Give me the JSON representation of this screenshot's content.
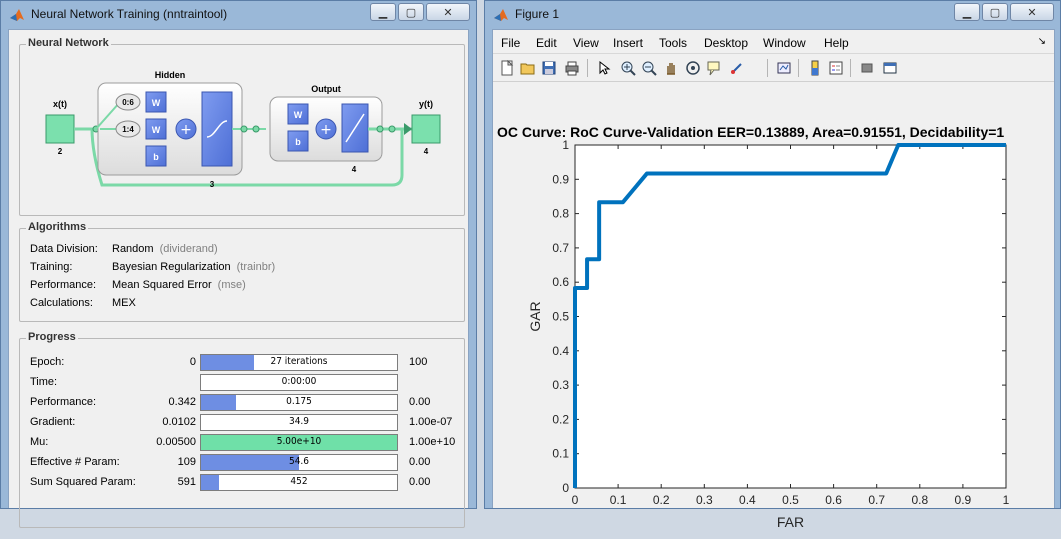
{
  "nntool": {
    "title": "Neural Network Training (nntraintool)",
    "network": {
      "panel_title": "Neural Network",
      "input_label": "x(t)",
      "input_size": "2",
      "hidden_label": "Hidden",
      "hidden_delay1": "0:6",
      "hidden_delay2": "1:4",
      "hidden_size": "3",
      "output_label": "Output",
      "output_size": "4",
      "y_label": "y(t)",
      "y_size": "4",
      "w": "W",
      "b": "b"
    },
    "algorithms": {
      "panel_title": "Algorithms",
      "rows": [
        {
          "label": "Data Division:",
          "value": "Random",
          "paren": "(dividerand)"
        },
        {
          "label": "Training:",
          "value": "Bayesian Regularization",
          "paren": "(trainbr)"
        },
        {
          "label": "Performance:",
          "value": "Mean Squared Error",
          "paren": "(mse)"
        },
        {
          "label": "Calculations:",
          "value": "MEX",
          "paren": ""
        }
      ]
    },
    "progress": {
      "panel_title": "Progress",
      "rows": [
        {
          "label": "Epoch:",
          "start": "0",
          "bar_text": "27 iterations",
          "end": "100",
          "fill": 0.27,
          "color": "#6e8ee3"
        },
        {
          "label": "Time:",
          "start": "",
          "bar_text": "0:00:00",
          "end": "",
          "fill": 0,
          "color": "#6e8ee3"
        },
        {
          "label": "Performance:",
          "start": "0.342",
          "bar_text": "0.175",
          "end": "0.00",
          "fill": 0.18,
          "color": "#6e8ee3"
        },
        {
          "label": "Gradient:",
          "start": "0.0102",
          "bar_text": "34.9",
          "end": "1.00e-07",
          "fill": 0,
          "color": "#6e8ee3"
        },
        {
          "label": "Mu:",
          "start": "0.00500",
          "bar_text": "5.00e+10",
          "end": "1.00e+10",
          "fill": 1.0,
          "color": "#6fe0a8"
        },
        {
          "label": "Effective # Param:",
          "start": "109",
          "bar_text": "54.6",
          "end": "0.00",
          "fill": 0.5,
          "color": "#6e8ee3"
        },
        {
          "label": "Sum Squared Param:",
          "start": "591",
          "bar_text": "452",
          "end": "0.00",
          "fill": 0.09,
          "color": "#6e8ee3"
        }
      ]
    }
  },
  "figure": {
    "title": "Figure 1",
    "menu": [
      "File",
      "Edit",
      "View",
      "Insert",
      "Tools",
      "Desktop",
      "Window",
      "Help"
    ],
    "toolbar_icons": [
      "new-figure-icon",
      "open-file-icon",
      "save-icon",
      "print-icon",
      "pointer-icon",
      "zoom-in-icon",
      "zoom-out-icon",
      "pan-icon",
      "rotate-icon",
      "data-cursor-icon",
      "brush-icon",
      "link-plot-icon",
      "colorbar-icon",
      "legend-icon",
      "hide-plot-tools-icon",
      "show-plot-tools-icon"
    ]
  },
  "chart_data": {
    "type": "line",
    "title": "OC Curve: RoC Curve-Validation   EER=0.13889,   Area=0.91551,   Decidability=1",
    "xlabel": "FAR",
    "ylabel": "GAR",
    "xlim": [
      0,
      1
    ],
    "ylim": [
      0,
      1
    ],
    "x_ticks": [
      "0",
      "0.1",
      "0.2",
      "0.3",
      "0.4",
      "0.5",
      "0.6",
      "0.7",
      "0.8",
      "0.9",
      "1"
    ],
    "y_ticks": [
      "0",
      "0.1",
      "0.2",
      "0.3",
      "0.4",
      "0.5",
      "0.6",
      "0.7",
      "0.8",
      "0.9",
      "1"
    ],
    "grid": false,
    "line_color": "#0072bd",
    "series": [
      {
        "x": [
          0,
          0,
          0.028,
          0.028,
          0.056,
          0.056,
          0.111,
          0.167,
          0.722,
          0.75,
          1.0
        ],
        "y": [
          0,
          0.583,
          0.583,
          0.667,
          0.667,
          0.833,
          0.833,
          0.917,
          0.917,
          1.0,
          1.0
        ]
      }
    ]
  }
}
